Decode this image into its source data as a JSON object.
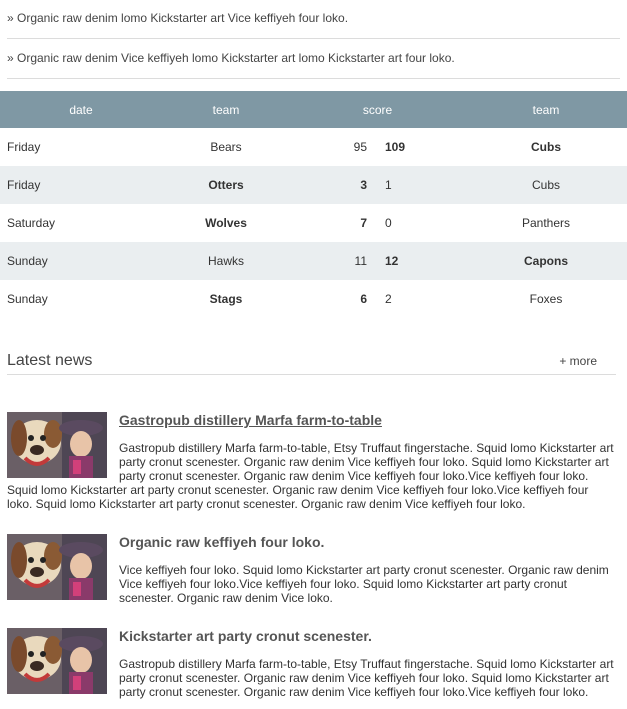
{
  "bullets": [
    "» Organic raw denim lomo Kickstarter art Vice keffiyeh four loko.",
    "» Organic raw denim Vice keffiyeh lomo Kickstarter art lomo Kickstarter art four loko."
  ],
  "table": {
    "headers": [
      "date",
      "team",
      "score",
      "team"
    ],
    "rows": [
      {
        "date": "Friday",
        "team1": "Bears",
        "score1": "95",
        "score2": "109",
        "team2": "Cubs",
        "winner": 2
      },
      {
        "date": "Friday",
        "team1": "Otters",
        "score1": "3",
        "score2": "1",
        "team2": "Cubs",
        "winner": 1
      },
      {
        "date": "Saturday",
        "team1": "Wolves",
        "score1": "7",
        "score2": "0",
        "team2": "Panthers",
        "winner": 1
      },
      {
        "date": "Sunday",
        "team1": "Hawks",
        "score1": "11",
        "score2": "12",
        "team2": "Capons",
        "winner": 2
      },
      {
        "date": "Sunday",
        "team1": "Stags",
        "score1": "6",
        "score2": "2",
        "team2": "Foxes",
        "winner": 1
      }
    ],
    "header_color": "#7f98a4",
    "alt_row_color": "#eaeef0"
  },
  "news": {
    "title": "Latest news",
    "more": "+ more",
    "items": [
      {
        "title": "Gastropub distillery Marfa farm-to-table",
        "text": "Gastropub distillery Marfa farm-to-table, Etsy Truffaut fingerstache. Squid lomo Kickstarter art party cronut scenester. Organic raw denim Vice keffiyeh four loko. Squid lomo Kickstarter art party cronut scenester. Organic raw denim Vice keffiyeh four loko.Vice keffiyeh four loko. Squid lomo Kickstarter art party cronut scenester. Organic raw denim Vice keffiyeh four loko.Vice keffiyeh four loko. Squid lomo Kickstarter art party cronut scenester. Organic raw denim Vice keffiyeh four loko."
      },
      {
        "title": "Organic raw keffiyeh four loko.",
        "text": "Vice keffiyeh four loko. Squid lomo Kickstarter art party cronut scenester. Organic raw denim Vice keffiyeh four loko.Vice keffiyeh four loko. Squid lomo Kickstarter art party cronut scenester. Organic raw denim Vice loko."
      },
      {
        "title": "Kickstarter art party cronut scenester.",
        "text": "Gastropub distillery Marfa farm-to-table, Etsy Truffaut fingerstache. Squid lomo Kickstarter art party cronut scenester. Organic raw denim Vice keffiyeh four loko. Squid lomo Kickstarter art party cronut scenester. Organic raw denim Vice keffiyeh four loko.Vice keffiyeh four loko."
      }
    ]
  }
}
